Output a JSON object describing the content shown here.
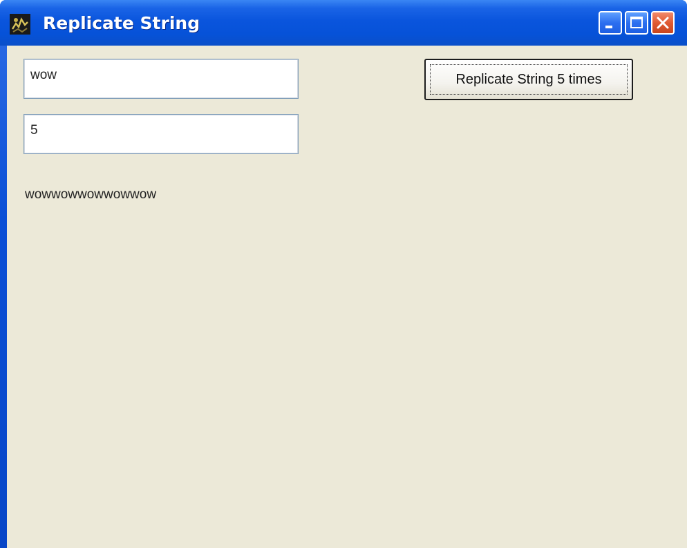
{
  "window": {
    "title": "Replicate String",
    "icons": {
      "app": "app-icon",
      "minimize": "minimize-icon",
      "maximize": "maximize-icon",
      "close": "close-icon"
    }
  },
  "form": {
    "string_value": "wow",
    "count_value": "5",
    "button_label": "Replicate String 5 times",
    "result_text": "wowwowwowwowwow"
  },
  "colors": {
    "titlebar": "#0a55dd",
    "client_background": "#ece9d8",
    "close_button": "#e05a32"
  }
}
